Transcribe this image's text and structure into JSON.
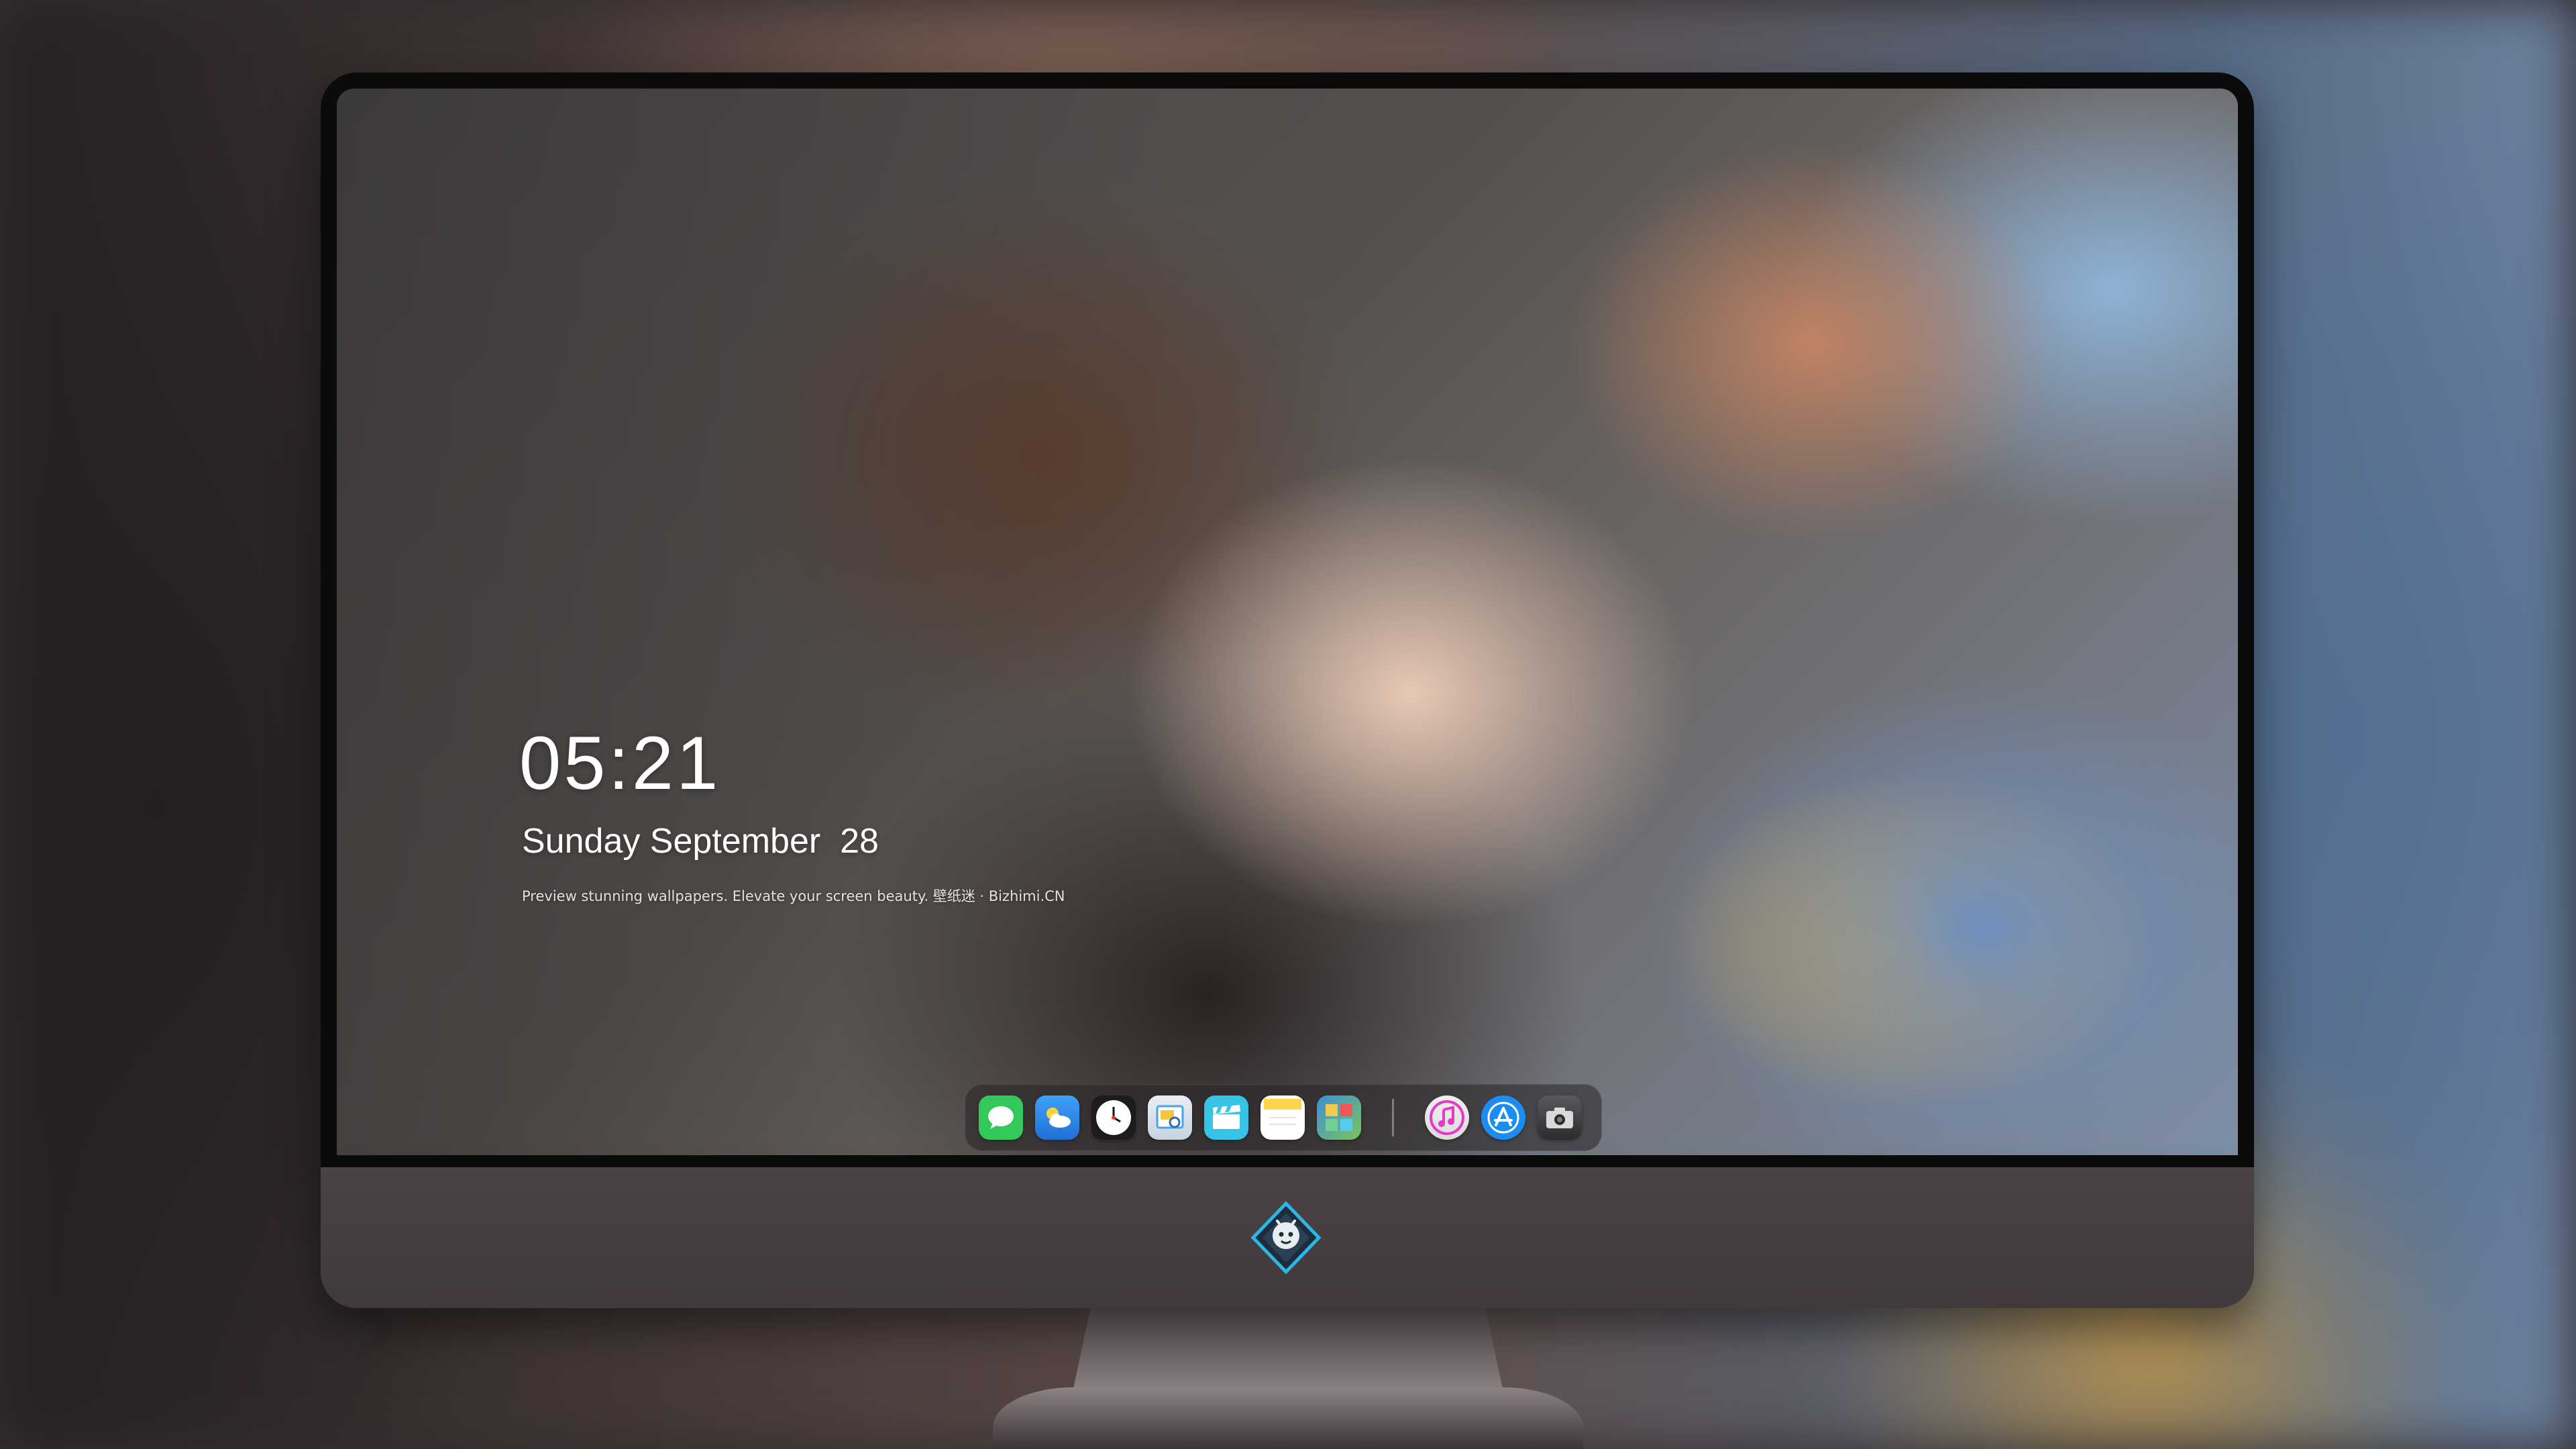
{
  "lockscreen": {
    "time": "05:21",
    "date": "Sunday September  28",
    "tagline": "Preview stunning wallpapers. Elevate your screen beauty. 壁纸迷 · Bizhimi.CN"
  },
  "dock": {
    "apps": [
      {
        "name": "Messages",
        "icon": "messages-icon",
        "color": "#34c759"
      },
      {
        "name": "Weather",
        "icon": "weather-icon",
        "color": "#2f8ef0"
      },
      {
        "name": "Clock",
        "icon": "clock-icon",
        "color": "#ffffff"
      },
      {
        "name": "Preview",
        "icon": "preview-icon",
        "color": "#4aa3e8"
      },
      {
        "name": "Final Cut Pro",
        "icon": "clapperboard-icon",
        "color": "#36c3e6"
      },
      {
        "name": "Notes",
        "icon": "notes-icon",
        "color": "#ffd54a"
      },
      {
        "name": "Photo Booth",
        "icon": "photos-icon",
        "color": "#3c8fd8"
      }
    ],
    "pinned": [
      {
        "name": "Music",
        "icon": "music-icon",
        "color": "#e43ac7"
      },
      {
        "name": "App Store",
        "icon": "app-store-icon",
        "color": "#1b8cf2"
      },
      {
        "name": "Camera",
        "icon": "camera-icon",
        "color": "#3a3a3c"
      }
    ]
  },
  "brand": {
    "logo": "dragon-shield-logo",
    "accent": "#2bb6e8"
  }
}
